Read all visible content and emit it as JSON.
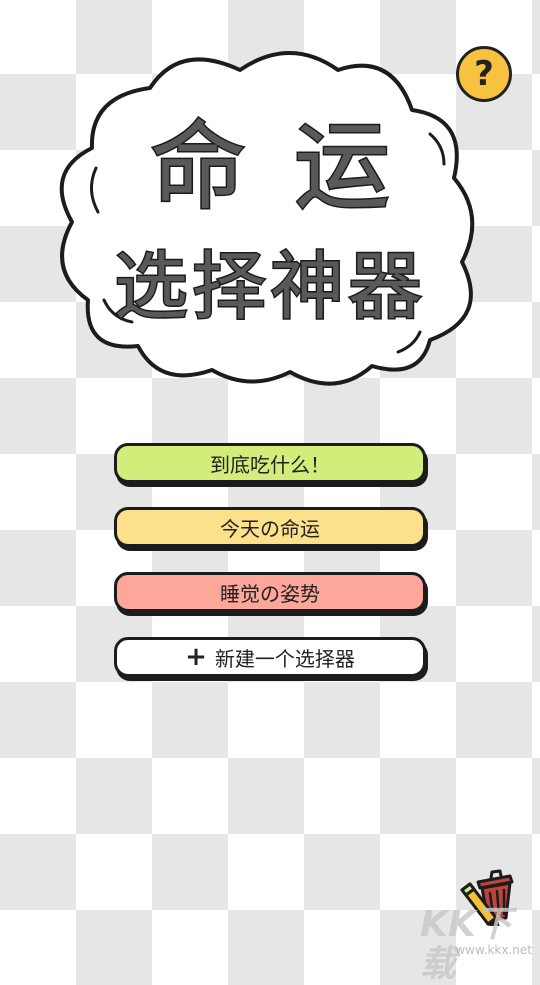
{
  "help": {
    "label": "?"
  },
  "title": {
    "line1": "命运",
    "line2": "选择神器"
  },
  "menu": {
    "items": [
      {
        "label": "到底吃什么！",
        "color": "#d2ed7a"
      },
      {
        "label": "今天の命运",
        "color": "#fde08a"
      },
      {
        "label": "睡觉の姿势",
        "color": "#fda79a"
      }
    ],
    "new_button": {
      "icon": "+",
      "label": "新建一个选择器"
    }
  },
  "toolbar": {
    "trash_icon": "trash-pencil-icon"
  },
  "watermark": {
    "main": "KK下载",
    "url": "www.kkx.net"
  },
  "colors": {
    "help": "#f7c23f",
    "title_fill": "#595959",
    "outline": "#1c1c1c"
  }
}
